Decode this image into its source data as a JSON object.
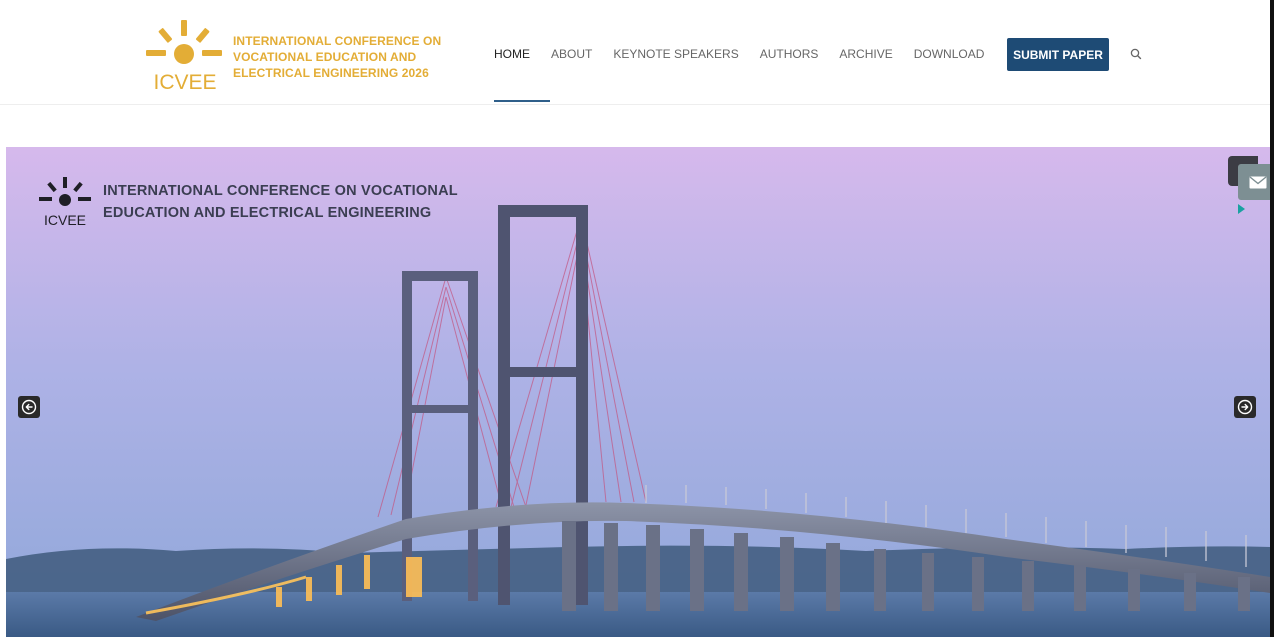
{
  "header": {
    "logo_label": "ICVEE",
    "logo_lines": [
      "INTERNATIONAL CONFERENCE ON",
      "VOCATIONAL EDUCATION AND",
      "ELECTRICAL ENGINEERING 2026"
    ],
    "nav": [
      {
        "label": "HOME",
        "active": true
      },
      {
        "label": "ABOUT"
      },
      {
        "label": "KEYNOTE SPEAKERS"
      },
      {
        "label": "AUTHORS"
      },
      {
        "label": "ARCHIVE"
      },
      {
        "label": "DOWNLOAD"
      }
    ],
    "submit_label": "SUBMIT PAPER",
    "search_icon": "search-icon"
  },
  "hero": {
    "logo_label": "ICVEE",
    "title_lines": [
      "INTERNATIONAL CONFERENCE ON VOCATIONAL",
      "EDUCATION AND ELECTRICAL ENGINEERING"
    ],
    "prev_icon": "arrow-left-circle-icon",
    "next_icon": "arrow-right-circle-icon",
    "mail_icon": "mail-icon"
  },
  "colors": {
    "brand_gold": "#e3ad36",
    "brand_blue": "#1e4b75",
    "nav_text": "#666666",
    "hero_title": "#3b3e52"
  }
}
